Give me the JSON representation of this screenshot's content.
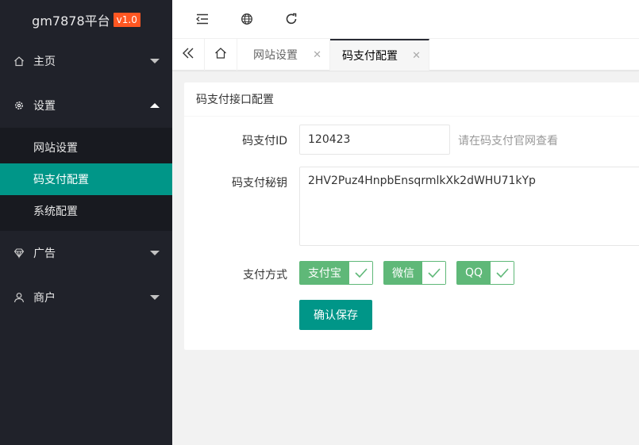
{
  "sidebar": {
    "logo_text": "gm7878平台",
    "version": "v1.0",
    "items": [
      {
        "label": "主页",
        "icon": "home-icon"
      },
      {
        "label": "设置",
        "icon": "gear-icon"
      },
      {
        "label": "广告",
        "icon": "diamond-icon"
      },
      {
        "label": "商户",
        "icon": "user-icon"
      }
    ],
    "settings_submenu": [
      {
        "label": "网站设置"
      },
      {
        "label": "码支付配置"
      },
      {
        "label": "系统配置"
      }
    ]
  },
  "header": {
    "icons": [
      "shrink-menu-icon",
      "globe-icon",
      "refresh-icon"
    ]
  },
  "tabs": [
    {
      "label": "网站设置"
    },
    {
      "label": "码支付配置"
    }
  ],
  "card": {
    "title": "码支付接口配置",
    "fields": {
      "id_label": "码支付ID",
      "id_value": "120423",
      "id_hint": "请在码支付官网查看",
      "secret_label": "码支付秘钥",
      "secret_value": "2HV2Puz4HnpbEnsqrmlkXk2dWHU71kYp",
      "payment_label": "支付方式",
      "payment_options": [
        {
          "label": "支付宝",
          "checked": true
        },
        {
          "label": "微信",
          "checked": true
        },
        {
          "label": "QQ",
          "checked": true
        }
      ]
    },
    "save_label": "确认保存"
  },
  "colors": {
    "sidebar_bg": "#20222a",
    "accent": "#009688",
    "checkbox": "#5fb878",
    "version_badge": "#ff5722"
  }
}
